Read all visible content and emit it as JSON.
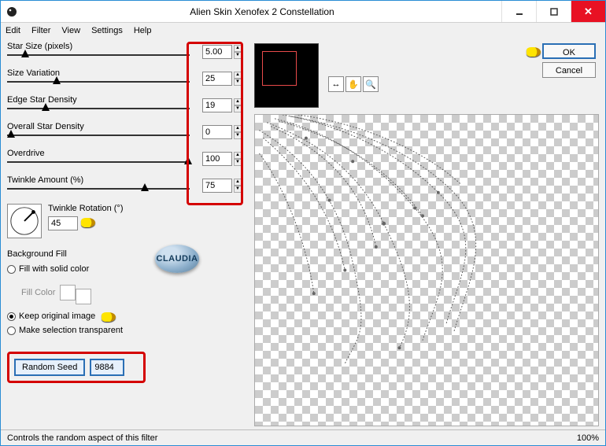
{
  "window": {
    "title": "Alien Skin Xenofex 2 Constellation"
  },
  "menu": {
    "edit": "Edit",
    "filter": "Filter",
    "view": "View",
    "settings": "Settings",
    "help": "Help"
  },
  "sliders": {
    "star_size": {
      "label": "Star Size (pixels)",
      "value": "5.00",
      "pos": 18
    },
    "size_var": {
      "label": "Size Variation",
      "value": "25",
      "pos": 58
    },
    "edge_dens": {
      "label": "Edge Star Density",
      "value": "19",
      "pos": 44
    },
    "overall": {
      "label": "Overall Star Density",
      "value": "0",
      "pos": 0
    },
    "overdrive": {
      "label": "Overdrive",
      "value": "100",
      "pos": 225
    },
    "twinkle_amt": {
      "label": "Twinkle Amount (%)",
      "value": "75",
      "pos": 170
    }
  },
  "twinkle_rotation": {
    "label": "Twinkle Rotation (°)",
    "value": "45"
  },
  "background_fill": {
    "header": "Background Fill",
    "opt_solid": "Fill with solid color",
    "fill_color_label": "Fill Color",
    "opt_keep": "Keep original image",
    "opt_trans": "Make selection transparent",
    "selected": "keep"
  },
  "random_seed": {
    "button": "Random Seed",
    "value": "9884"
  },
  "toolbar": {
    "move_icon": "↔",
    "hand_icon": "✋",
    "zoom_icon": "🔍"
  },
  "buttons": {
    "ok": "OK",
    "cancel": "Cancel"
  },
  "logo_text": "CLAUDIA",
  "status": {
    "help": "Controls the random aspect of this filter",
    "zoom": "100%"
  }
}
